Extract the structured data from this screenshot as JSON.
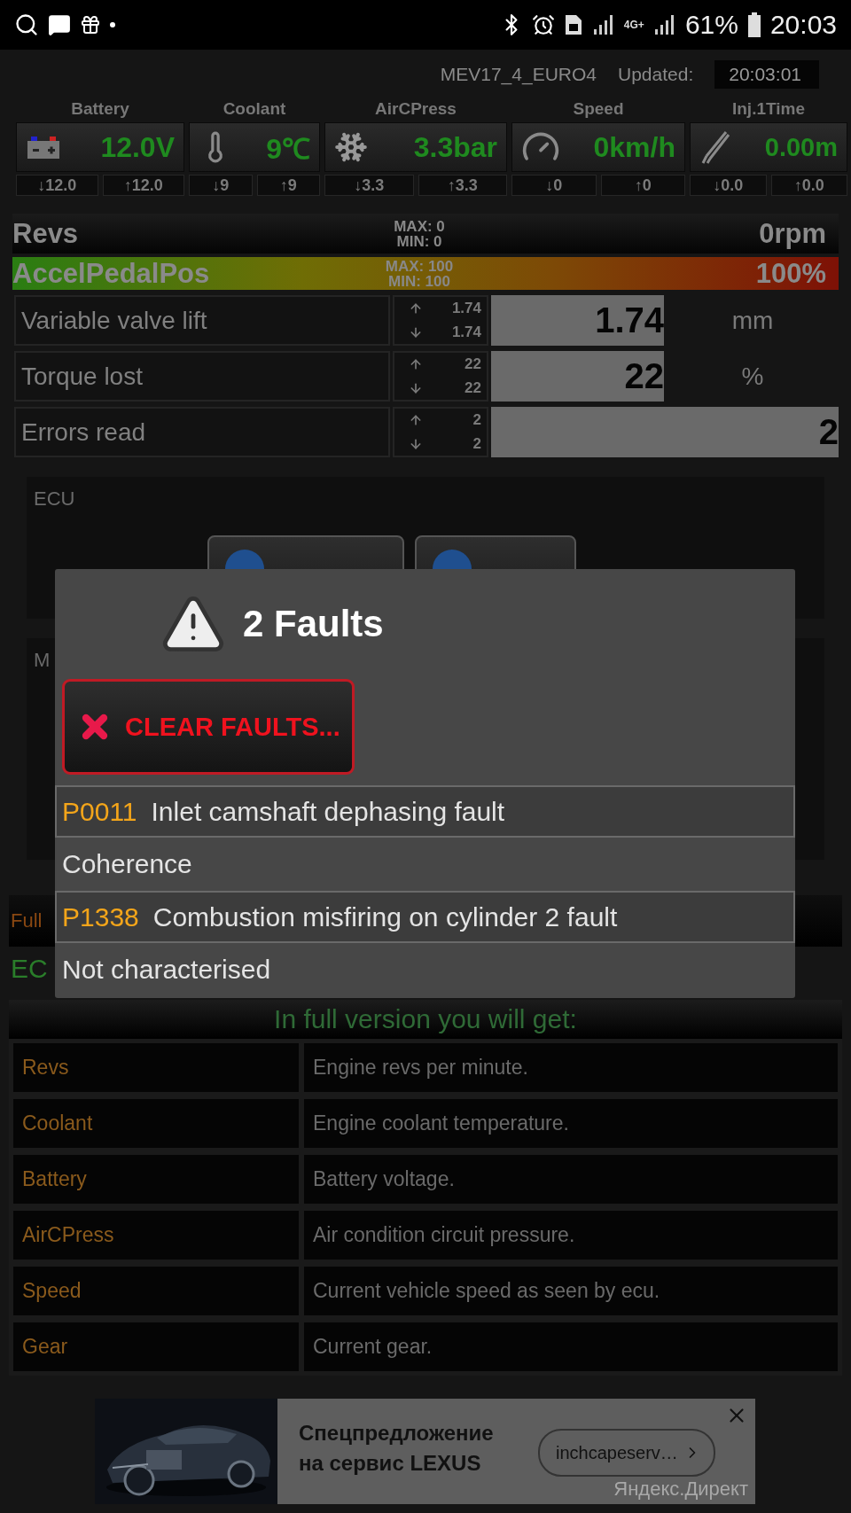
{
  "status_bar": {
    "network": "4G+",
    "battery": "61%",
    "time": "20:03"
  },
  "header": {
    "ecu": "MEV17_4_EURO4",
    "updated_label": "Updated:",
    "updated_value": "20:03:01"
  },
  "gauges": [
    {
      "label": "Battery",
      "value": "12.0V",
      "min": "↓12.0",
      "max": "↑12.0"
    },
    {
      "label": "Coolant",
      "value": "9℃",
      "min": "↓9",
      "max": "↑9"
    },
    {
      "label": "AirCPress",
      "value": "3.3bar",
      "min": "↓3.3",
      "max": "↑3.3"
    },
    {
      "label": "Speed",
      "value": "0km/h",
      "min": "↓0",
      "max": "↑0"
    },
    {
      "label": "Inj.1Time",
      "value": "0.00m",
      "min": "↓0.0",
      "max": "↑0.0"
    }
  ],
  "bars": [
    {
      "kind": "plain",
      "label": "Revs",
      "max": "MAX: 0",
      "min": "MIN: 0",
      "value": "0rpm"
    },
    {
      "kind": "gradient",
      "label": "AccelPedalPos",
      "max": "MAX: 100",
      "min": "MIN: 100",
      "value": "100%",
      "level": 1
    }
  ],
  "params": [
    {
      "label": "Variable valve lift",
      "up": "1.74",
      "down": "1.74",
      "value": "1.74",
      "unit": "mm"
    },
    {
      "label": "Torque lost",
      "up": "22",
      "down": "22",
      "value": "22",
      "unit": "%"
    },
    {
      "label": "Errors read",
      "up": "2",
      "down": "2",
      "value": "2"
    }
  ],
  "ecu_panel": {
    "title": "ECU",
    "buttons": [
      {
        "kind": "module"
      },
      {
        "kind": "module"
      }
    ]
  },
  "module_panel": {
    "title": "M"
  },
  "full_version_bar": {
    "text": "Full",
    "ecu": "EC"
  },
  "dialog": {
    "title": "2 Faults",
    "clear_button": "CLEAR FAULTS...",
    "faults": [
      {
        "code": "P0011",
        "description": "Inlet camshaft dephasing fault",
        "detail": "Coherence"
      },
      {
        "code": "P1338",
        "description": "Combustion misfiring on cylinder 2 fault",
        "detail": "Not characterised"
      }
    ]
  },
  "features": {
    "title": "In full version you will get:",
    "rows": [
      {
        "name": "Revs",
        "description": "Engine revs per minute."
      },
      {
        "name": "Coolant",
        "description": "Engine coolant temperature."
      },
      {
        "name": "Battery",
        "description": "Battery voltage."
      },
      {
        "name": "AirCPress",
        "description": "Air condition circuit pressure."
      },
      {
        "name": "Speed",
        "description": "Current vehicle speed as seen by ecu."
      },
      {
        "name": "Gear",
        "description": "Current gear."
      }
    ]
  },
  "ad": {
    "headline": "Спецпредложение на сервис LEXUS",
    "link": "inchcapeserv…",
    "source": "Яндекс.Директ"
  }
}
